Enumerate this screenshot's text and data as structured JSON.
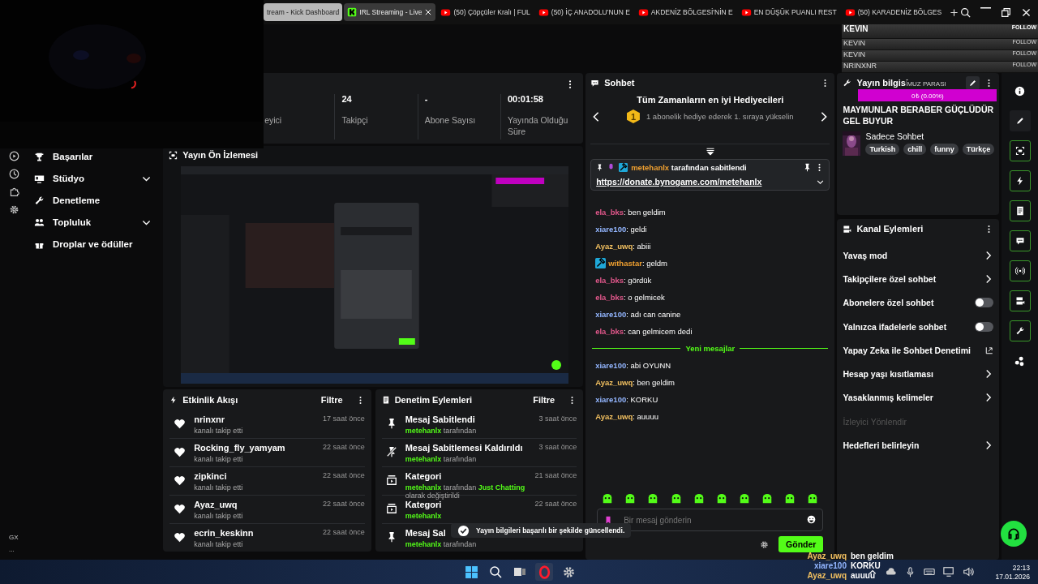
{
  "browser_tabs": [
    {
      "title": "tream - Kick Dashboard",
      "kind": "plain",
      "selected": true,
      "hovered": false
    },
    {
      "title": "IRL Streaming - Live",
      "kind": "kick",
      "selected": false,
      "hovered": true
    },
    {
      "title": "(50) Çöpçüler Kralı | FUL",
      "kind": "youtube",
      "selected": false,
      "hovered": false
    },
    {
      "title": "(50) İÇ ANADOLU'NUN E",
      "kind": "youtube",
      "selected": false,
      "hovered": false
    },
    {
      "title": "AKDENİZ BÖLGESİ'NİN E",
      "kind": "youtube",
      "selected": false,
      "hovered": false
    },
    {
      "title": "EN DÜŞÜK PUANLI REST",
      "kind": "youtube",
      "selected": false,
      "hovered": false
    },
    {
      "title": "(50) KARADENİZ BÖLGES",
      "kind": "youtube",
      "selected": false,
      "hovered": false
    }
  ],
  "follow_overlay": [
    {
      "name": "KEVIN",
      "action": "FOLLOW"
    },
    {
      "name": "KEVIN",
      "action": "FOLLOW"
    },
    {
      "name": "KEVIN",
      "action": "FOLLOW"
    },
    {
      "name": "NRINXNR",
      "action": "FOLLOW"
    }
  ],
  "sidebar": {
    "items": [
      {
        "label": "Başarılar",
        "expandable": false
      },
      {
        "label": "Stüdyo",
        "expandable": true
      },
      {
        "label": "Denetleme",
        "expandable": false
      },
      {
        "label": "Topluluk",
        "expandable": true
      },
      {
        "label": "Droplar ve ödüller",
        "expandable": false
      }
    ],
    "browser_label": "GX",
    "more": "..."
  },
  "stats": [
    {
      "label": "eyici"
    },
    {
      "value": "24",
      "label": "Takipçi"
    },
    {
      "value": "-",
      "label": "Abone Sayısı"
    },
    {
      "value": "00:01:58",
      "label": "Yayında Olduğu Süre"
    }
  ],
  "preview": {
    "title": "Yayın Ön İzlemesi",
    "kind": "picture"
  },
  "activity_feed": {
    "title": "Etkinlik Akışı",
    "filter": "Filtre",
    "items": [
      {
        "name": "nrinxnr",
        "detail": "kanalı takip etti",
        "time": "17 saat önce"
      },
      {
        "name": "Rocking_fly_yamyam",
        "detail": "kanalı takip etti",
        "time": "22 saat önce"
      },
      {
        "name": "zipkinci",
        "detail": "kanalı takip etti",
        "time": "22 saat önce"
      },
      {
        "name": "Ayaz_uwq",
        "detail": "kanalı takip etti",
        "time": "22 saat önce"
      },
      {
        "name": "ecrin_keskinn",
        "detail": "kanalı takip etti",
        "time": "22 saat önce"
      }
    ]
  },
  "moderation": {
    "title": "Denetim Eylemleri",
    "filter": "Filtre",
    "items": [
      {
        "kind": "pin",
        "title": "Mesaj Sabitlendi",
        "time": "3 saat önce",
        "detail": [
          {
            "text": "metehanlx",
            "highlight": true
          },
          {
            "text": " tarafından",
            "highlight": false
          }
        ]
      },
      {
        "kind": "unpin",
        "title": "Mesaj Sabitlemesi Kaldırıldı",
        "time": "3 saat önce",
        "detail": [
          {
            "text": "metehanlx",
            "highlight": true
          },
          {
            "text": " tarafından",
            "highlight": false
          }
        ]
      },
      {
        "kind": "category",
        "title": "Kategori",
        "time": "21 saat önce",
        "detail": [
          {
            "text": "metehanlx",
            "highlight": true
          },
          {
            "text": " tarafından ",
            "highlight": false
          },
          {
            "text": "Just Chatting",
            "highlight": true
          },
          {
            "text": " olarak değiştirildi",
            "highlight": false
          }
        ]
      },
      {
        "kind": "category",
        "title": "Kategori",
        "time": "22 saat önce",
        "detail": [
          {
            "text": "metehanlx",
            "highlight": true
          }
        ]
      },
      {
        "kind": "pin",
        "title": "Mesaj Sal",
        "detail": [
          {
            "text": "metehanlx",
            "highlight": true
          },
          {
            "text": " tarafından",
            "highlight": false
          }
        ]
      }
    ]
  },
  "toast": {
    "text": "Yayın bilgileri başarılı bir şekilde güncellendi."
  },
  "chat": {
    "title": "Sohbet",
    "gifters_title": "Tüm Zamanların en iyi Hediyecileri",
    "gifter_rank": "1",
    "gifter_hint": "1 abonelik hediye ederek 1. sıraya yükselin",
    "pinned": {
      "user": "metehanlx",
      "suffix": " tarafından sabitlendi",
      "link": "https://donate.bynogame.com/metehanlx"
    },
    "messages": [
      {
        "kind": "message",
        "user": "ela_bks",
        "color": "#e0578a",
        "text": ": ben geldim",
        "moderator": false
      },
      {
        "kind": "message",
        "user": "xiare100",
        "color": "#93b6ff",
        "text": ": geldi",
        "moderator": false
      },
      {
        "kind": "message",
        "user": "Ayaz_uwq",
        "color": "#f2c060",
        "text": ": abiii",
        "moderator": false
      },
      {
        "kind": "message",
        "user": "withastar",
        "color": "#f0a030",
        "text": ": geldm",
        "moderator": true
      },
      {
        "kind": "message",
        "user": "ela_bks",
        "color": "#e0578a",
        "text": ": gördük",
        "moderator": false
      },
      {
        "kind": "message",
        "user": "ela_bks",
        "color": "#e0578a",
        "text": ": o gelmicek",
        "moderator": false
      },
      {
        "kind": "message",
        "user": "xiare100",
        "color": "#93b6ff",
        "text": ": adı can canine",
        "moderator": false
      },
      {
        "kind": "message",
        "user": "ela_bks",
        "color": "#e0578a",
        "text": ": can gelmicem dedi",
        "moderator": false
      },
      {
        "kind": "divider",
        "text": "Yeni mesajlar"
      },
      {
        "kind": "message",
        "user": "xiare100",
        "color": "#93b6ff",
        "text": ": abi OYUNN",
        "moderator": false
      },
      {
        "kind": "message",
        "user": "Ayaz_uwq",
        "color": "#f2c060",
        "text": ": ben geldim",
        "moderator": false
      },
      {
        "kind": "message",
        "user": "xiare100",
        "color": "#93b6ff",
        "text": ": KORKU",
        "moderator": false
      },
      {
        "kind": "message",
        "user": "Ayaz_uwq",
        "color": "#f2c060",
        "text": ": auuuu",
        "moderator": false
      }
    ],
    "input": {
      "placeholder": "Bir mesaj gönderin"
    },
    "send": "Gönder"
  },
  "stream_info": {
    "title": "Yayın bilgisi",
    "stream_title": "MAYMUNLAR BERABER GÜÇLÜDÜR GEL BUYUR",
    "category": "Sadece Sohbet",
    "tags": [
      "Turkish",
      "chill",
      "funny",
      "Türkçe"
    ],
    "goal_label": "MUZ PARASI",
    "goal_amount": "0₺ (0.00%)"
  },
  "channel_actions": {
    "title": "Kanal Eylemleri",
    "items": [
      {
        "kind": "link",
        "label": "Yavaş mod"
      },
      {
        "kind": "link",
        "label": "Takipçilere özel sohbet"
      },
      {
        "kind": "toggle",
        "label": "Abonelere özel sohbet",
        "on": false
      },
      {
        "kind": "toggle",
        "label": "Yalnızca ifadelerle sohbet",
        "on": false
      },
      {
        "kind": "external",
        "label": "Yapay Zeka ile Sohbet Denetimi"
      },
      {
        "kind": "link",
        "label": "Hesap yaşı kısıtlaması"
      },
      {
        "kind": "link",
        "label": "Yasaklanmış kelimeler"
      },
      {
        "kind": "heading",
        "label": "İzleyici Yönlendir"
      },
      {
        "kind": "link",
        "label": "Hedefleri belirleyin"
      }
    ]
  },
  "chat_overlay": [
    {
      "user": "Ayaz_uwq",
      "color": "#f2c060",
      "text": "ben geldim"
    },
    {
      "user": "xiare100",
      "color": "#93b6ff",
      "text": "KORKU"
    },
    {
      "user": "Ayaz_uwq",
      "color": "#f2c060",
      "text": "auuuu"
    }
  ],
  "taskbar": {
    "time": "22:13",
    "date": "17.01.2026"
  }
}
